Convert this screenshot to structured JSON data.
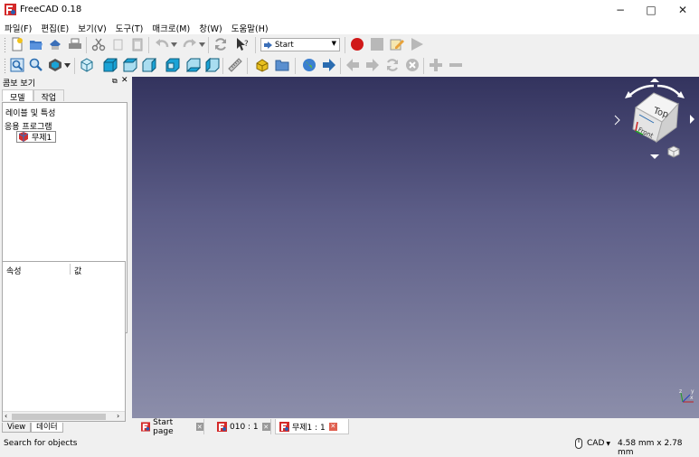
{
  "window": {
    "title": "FreeCAD 0.18",
    "min_glyph": "−",
    "max_glyph": "□",
    "close_glyph": "✕"
  },
  "menu": [
    "파일(F)",
    "편집(E)",
    "보기(V)",
    "도구(T)",
    "매크로(M)",
    "창(W)",
    "도움말(H)"
  ],
  "toolbar": {
    "workbench": "Start"
  },
  "combo": {
    "title": "콤보 보기",
    "tabs": [
      "모델",
      "작업"
    ],
    "tree": {
      "header": "레이블 및 특성",
      "group": "응용 프로그램",
      "item": "무제1"
    },
    "properties": {
      "col_property": "속성",
      "col_value": "값"
    },
    "bottom_tabs": [
      "View",
      "데이터"
    ]
  },
  "navcube": {
    "top": "Top",
    "front": "Front"
  },
  "doc_tabs": [
    {
      "label": "Start page",
      "active": false
    },
    {
      "label": "010 : 1",
      "active": false
    },
    {
      "label": "무제1 : 1",
      "active": true
    }
  ],
  "status": {
    "message": "Search for objects",
    "nav_style": "CAD",
    "dimensions": "4.58 mm x 2.78 mm"
  },
  "colors": {
    "accent_red": "#d01818",
    "view_top": "#33335e",
    "view_bottom": "#8c8eaa",
    "cube_blue": "#1ba3d6"
  }
}
